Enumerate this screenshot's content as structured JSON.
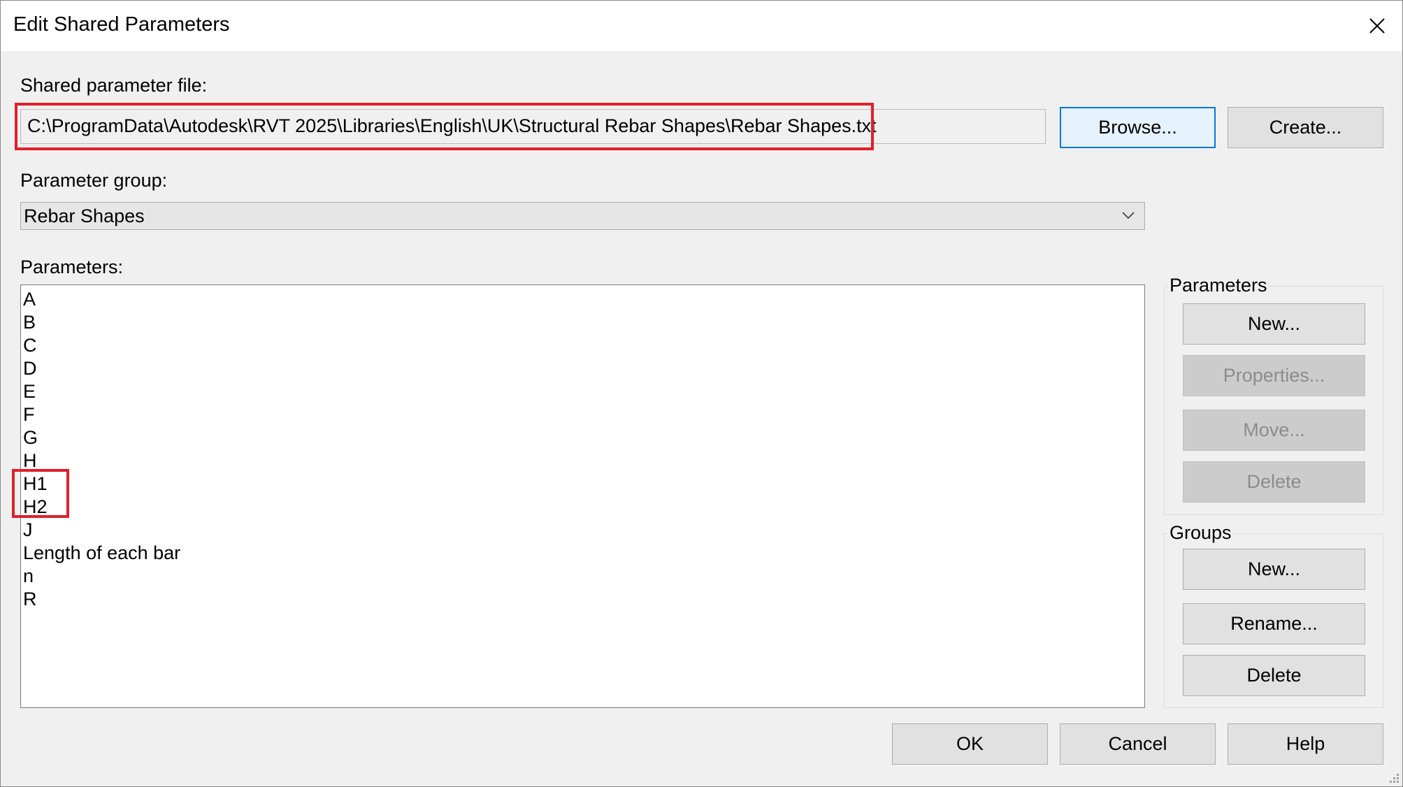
{
  "window": {
    "title": "Edit Shared Parameters",
    "close_icon": "close-icon"
  },
  "file_section": {
    "label": "Shared parameter file:",
    "path": "C:\\ProgramData\\Autodesk\\RVT 2025\\Libraries\\English\\UK\\Structural Rebar Shapes\\Rebar Shapes.txt",
    "browse_label": "Browse...",
    "create_label": "Create..."
  },
  "group_section": {
    "label": "Parameter group:",
    "selected": "Rebar Shapes"
  },
  "parameters_section": {
    "label": "Parameters:",
    "items": [
      "A",
      "B",
      "C",
      "D",
      "E",
      "F",
      "G",
      "H",
      "H1",
      "H2",
      "J",
      "Length of each bar",
      "n",
      "R"
    ]
  },
  "parameters_box": {
    "title": "Parameters",
    "new_label": "New...",
    "properties_label": "Properties...",
    "move_label": "Move...",
    "delete_label": "Delete"
  },
  "groups_box": {
    "title": "Groups",
    "new_label": "New...",
    "rename_label": "Rename...",
    "delete_label": "Delete"
  },
  "footer": {
    "ok_label": "OK",
    "cancel_label": "Cancel",
    "help_label": "Help"
  },
  "colors": {
    "highlight": "#e0202a",
    "focus": "#0078d7"
  }
}
